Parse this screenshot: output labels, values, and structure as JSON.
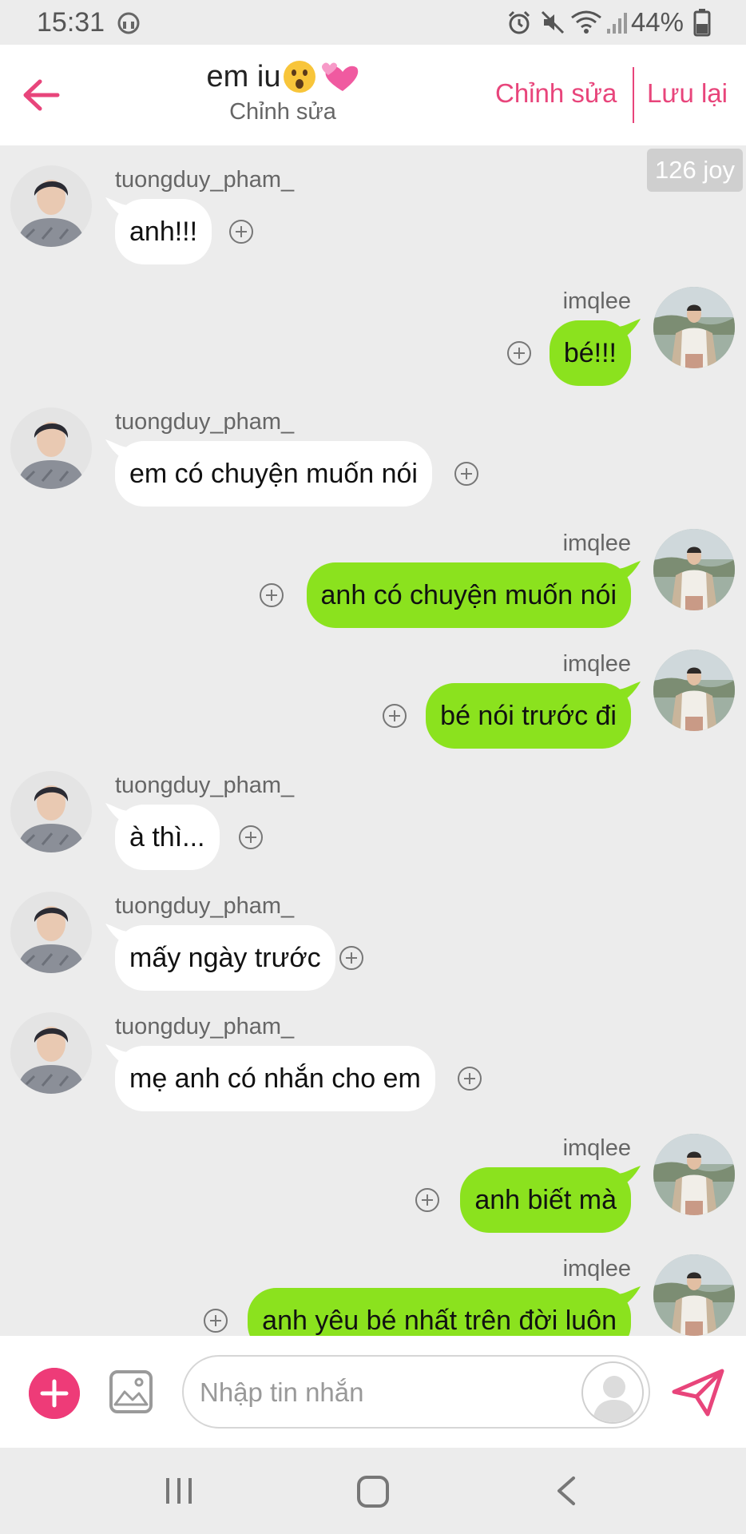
{
  "status_bar": {
    "time": "15:31",
    "battery": "44%",
    "icons": [
      "headset-icon",
      "alarm-icon",
      "mute-icon",
      "wifi-icon",
      "signal-icon",
      "battery-icon"
    ]
  },
  "header": {
    "title": "em iu",
    "title_emojis": [
      "astonished-face-emoji",
      "revolving-hearts-emoji"
    ],
    "subtitle": "Chỉnh sửa",
    "edit_label": "Chỉnh sửa",
    "save_label": "Lưu lại",
    "accent_color": "#e8457b"
  },
  "chat": {
    "joy_badge": "126 joy",
    "bubble_colors": {
      "incoming": "#ffffff",
      "outgoing": "#8be21e"
    },
    "messages": [
      {
        "sender": "tuongduy_pham_",
        "side": "left",
        "text": "anh!!!"
      },
      {
        "sender": "imqlee",
        "side": "right",
        "text": "bé!!!"
      },
      {
        "sender": "tuongduy_pham_",
        "side": "left",
        "text": "em có chuyện muốn nói"
      },
      {
        "sender": "imqlee",
        "side": "right",
        "text": "anh có chuyện muốn nói"
      },
      {
        "sender": "imqlee",
        "side": "right",
        "text": "bé nói trước đi"
      },
      {
        "sender": "tuongduy_pham_",
        "side": "left",
        "text": "à thì..."
      },
      {
        "sender": "tuongduy_pham_",
        "side": "left",
        "text": "mấy ngày trước"
      },
      {
        "sender": "tuongduy_pham_",
        "side": "left",
        "text": "mẹ anh có nhắn cho em"
      },
      {
        "sender": "imqlee",
        "side": "right",
        "text": "anh biết mà"
      },
      {
        "sender": "imqlee",
        "side": "right",
        "text": "anh yêu bé nhất trên đời luôn"
      }
    ]
  },
  "input_bar": {
    "placeholder": "Nhập tin nhắn",
    "value": "",
    "plus_color": "#ee3b78",
    "send_color": "#e8457b"
  },
  "nav_bar": {
    "buttons": [
      "recent-apps-icon",
      "home-icon",
      "back-nav-icon"
    ]
  }
}
